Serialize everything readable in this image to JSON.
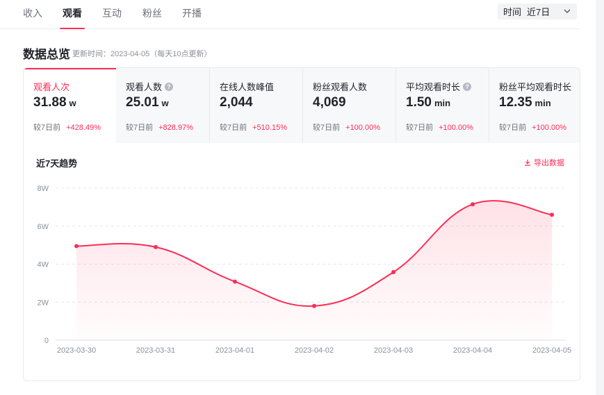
{
  "tabs": [
    {
      "label": "收入",
      "active": false
    },
    {
      "label": "观看",
      "active": true
    },
    {
      "label": "互动",
      "active": false
    },
    {
      "label": "粉丝",
      "active": false
    },
    {
      "label": "开播",
      "active": false
    }
  ],
  "time_filter": {
    "label": "时间",
    "value": "近7日"
  },
  "overview": {
    "title": "数据总览",
    "subtitle": "更新时间：2023-04-05（每天10点更新）"
  },
  "metrics": [
    {
      "title": "观看人次",
      "value": "31.88",
      "unit": "w",
      "compare_label": "较7日前",
      "delta": "+428.49%",
      "active": true,
      "help": false
    },
    {
      "title": "观看人数",
      "value": "25.01",
      "unit": "w",
      "compare_label": "较7日前",
      "delta": "+828.97%",
      "active": false,
      "help": true
    },
    {
      "title": "在线人数峰值",
      "value": "2,044",
      "unit": "",
      "compare_label": "较7日前",
      "delta": "+510.15%",
      "active": false,
      "help": false
    },
    {
      "title": "粉丝观看人数",
      "value": "4,069",
      "unit": "",
      "compare_label": "较7日前",
      "delta": "+100.00%",
      "active": false,
      "help": false
    },
    {
      "title": "平均观看时长",
      "value": "1.50",
      "unit": "min",
      "compare_label": "较7日前",
      "delta": "+100.00%",
      "active": false,
      "help": true
    },
    {
      "title": "粉丝平均观看时长",
      "value": "12.35",
      "unit": "min",
      "compare_label": "较7日前",
      "delta": "+100.00%",
      "active": false,
      "help": false
    }
  ],
  "trend": {
    "title": "近7天趋势",
    "export_label": "导出数据"
  },
  "colors": {
    "accent": "#fe2c55",
    "grid": "#e5e6eb",
    "axis_text": "#86909c"
  },
  "icons": {
    "help": "question-circle-icon",
    "export": "download-icon",
    "dropdown": "chevron-down-icon"
  },
  "chart_data": {
    "type": "area",
    "title": "近7天趋势",
    "x": [
      "2023-03-30",
      "2023-03-31",
      "2023-04-01",
      "2023-04-02",
      "2023-04-03",
      "2023-04-04",
      "2023-04-05"
    ],
    "series": [
      {
        "values": [
          49500,
          49000,
          30800,
          18000,
          35800,
          71500,
          66000
        ]
      }
    ],
    "ylim": [
      0,
      80000
    ],
    "yticks": [
      0,
      20000,
      40000,
      60000,
      80000
    ],
    "ytick_labels": [
      "0",
      "2W",
      "4W",
      "6W",
      "8W"
    ],
    "grid": true,
    "smooth": true
  }
}
